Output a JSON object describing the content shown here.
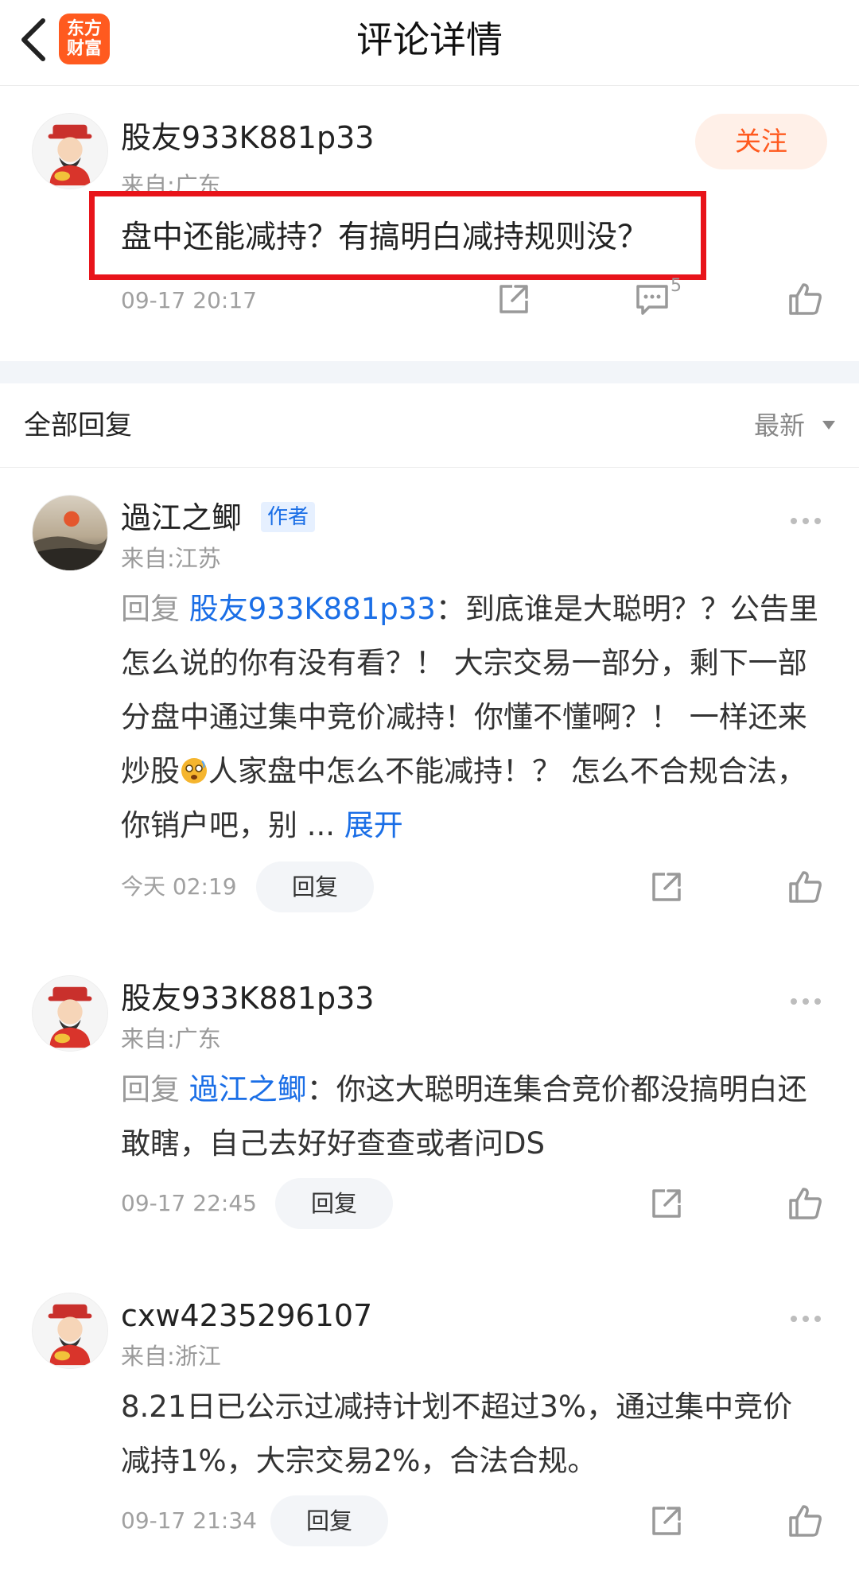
{
  "header": {
    "title": "评论详情",
    "logo_line1": "东方",
    "logo_line2": "财富"
  },
  "main_comment": {
    "username": "股友933K881p33",
    "location": "来自:广东",
    "follow_label": "关注",
    "text": "盘中还能减持？有搞明白减持规则没？",
    "time": "09-17 20:17",
    "comment_count": "5"
  },
  "replies_header": {
    "title": "全部回复",
    "sort_label": "最新"
  },
  "replies": [
    {
      "username": "過江之鲫",
      "badge": "作者",
      "location": "来自:江苏",
      "prefix": "回复",
      "target": "股友933K881p33",
      "text_a": "：到底谁是大聪明？？公告里怎么说的你有没有看？！ 大宗交易一部分，剩下一部分盘中通过集中竞价减持！你懂不懂啊？！ 一样还来炒股",
      "text_b": "人家盘中怎么不能减持！？ 怎么不合规合法，你销户吧，别 ...",
      "expand": "展开",
      "time": "今天 02:19",
      "reply_label": "回复"
    },
    {
      "username": "股友933K881p33",
      "location": "来自:广东",
      "prefix": "回复",
      "target": "過江之鲫",
      "text_a": "：你这大聪明连集合竞价都没搞明白还敢瞎，自己去好好查查或者问DS",
      "time": "09-17 22:45",
      "reply_label": "回复"
    },
    {
      "username": "cxw4235296107",
      "location": "来自:浙江",
      "text_a": "8.21日已公示过减持计划不超过3%，通过集中竞价减持1%，大宗交易2%，合法合规。",
      "time": "09-17 21:34",
      "reply_label": "回复"
    }
  ],
  "colors": {
    "brand": "#ff5a1f",
    "link": "#1a6ee6",
    "highlight": "#e8141a"
  }
}
